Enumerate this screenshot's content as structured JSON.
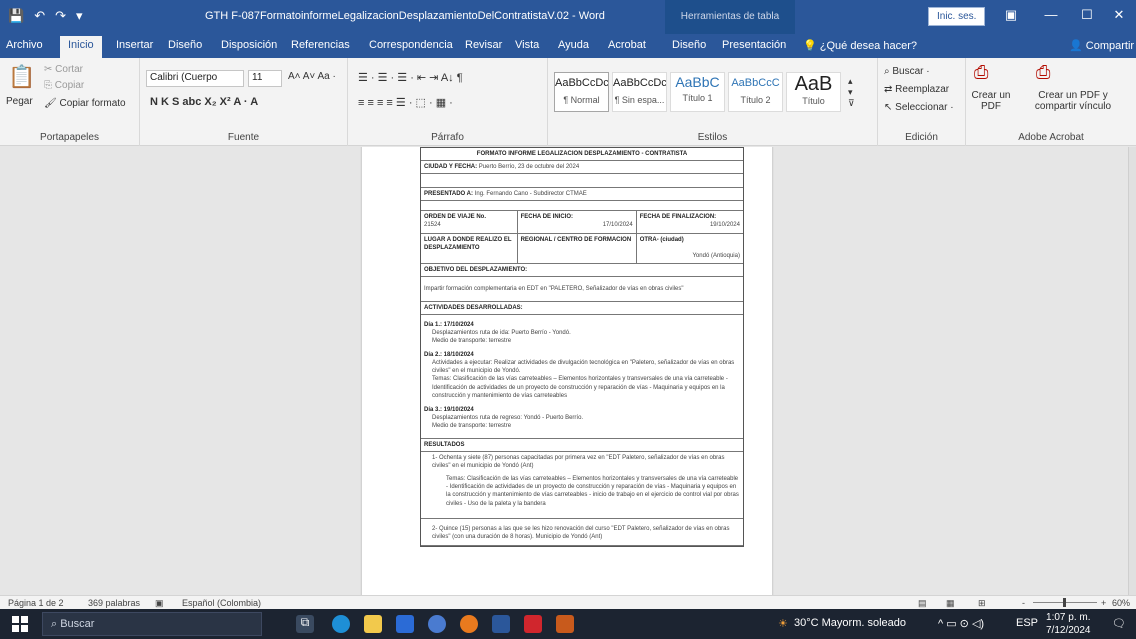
{
  "titlebar": {
    "quick_access": [
      "💾",
      "↶",
      "↷",
      "▾"
    ],
    "doc_title": "GTH F-087FormatoinformeLegalizacionDesplazamientoDelContratistaV.02 - Word",
    "table_tools": "Herramientas de tabla",
    "sign_in": "Inic. ses.",
    "ribbon_display": "▣",
    "minimize": "—",
    "maximize": "☐",
    "close": "✕"
  },
  "tabs": {
    "items": [
      "Archivo",
      "Inicio",
      "Insertar",
      "Diseño",
      "Disposición",
      "Referencias",
      "Correspondencia",
      "Revisar",
      "Vista",
      "Ayuda",
      "Acrobat",
      "Diseño",
      "Presentación"
    ],
    "active_index": 1,
    "tell_me": "¿Qué desea hacer?",
    "share": "Compartir"
  },
  "ribbon": {
    "clipboard": {
      "label": "Portapapeles",
      "paste": "Pegar",
      "cut": "Cortar",
      "copy": "Copiar",
      "format_painter": "Copiar formato"
    },
    "font": {
      "label": "Fuente",
      "name": "Calibri (Cuerpo",
      "size": "11",
      "row2": "N  K  S  abc  X₂  X²   A  ·  A"
    },
    "paragraph": {
      "label": "Párrafo",
      "row1": "☰ · ☰ · ☰ ·   ⇤  ⇥   A↓  ¶",
      "row2": "≡  ≡  ≡  ≡   ☰ ·   ⬚ ·  ▦ ·"
    },
    "styles": {
      "label": "Estilos",
      "items": [
        {
          "preview": "AaBbCcDc",
          "name": "¶ Normal"
        },
        {
          "preview": "AaBbCcDc",
          "name": "¶ Sin espa..."
        },
        {
          "preview": "AaBbC",
          "name": "Título 1"
        },
        {
          "preview": "AaBbCcC",
          "name": "Título 2"
        },
        {
          "preview": "AaB",
          "name": "Título"
        }
      ]
    },
    "editing": {
      "label": "Edición",
      "find": "Buscar",
      "replace": "Reemplazar",
      "select": "Seleccionar"
    },
    "acrobat": {
      "label": "Adobe Acrobat",
      "create_pdf": "Crear un PDF",
      "create_share": "Crear un PDF y compartir vínculo"
    }
  },
  "document": {
    "heading": "FORMATO INFORME LEGALIZACION DESPLAZAMIENTO - CONTRATISTA",
    "city_date_label": "CIUDAD Y FECHA:",
    "city_date_value": "Puerto Berrío, 23 de octubre del 2024",
    "presented_label": "PRESENTADO A:",
    "presented_value": "Ing. Fernando Cano - Subdirector CTMAE",
    "order_label": "ORDEN DE VIAJE No.",
    "order_value": "21524",
    "start_label": "FECHA DE INICIO:",
    "start_value": "17/10/2024",
    "end_label": "FECHA DE FINALIZACION:",
    "end_value": "19/10/2024",
    "place_label": "LUGAR A DONDE REALIZO EL DESPLAZAMIENTO",
    "regional_label": "REGIONAL / CENTRO DE FORMACION",
    "other_label": "OTRA- (ciudad)",
    "other_value": "Yondó (Antioquia)",
    "objective_label": "OBJETIVO DEL DESPLAZAMIENTO:",
    "objective_value": "Impartir formación complementaria en EDT en \"PALETERO, Señalizador de vías en obras civiles\"",
    "activities_label": "ACTIVIDADES DESARROLLADAS:",
    "day1_title": "Día 1.: 17/10/2024",
    "day1_lines": [
      "Desplazamientos ruta de ida: Puerto Berrío - Yondó.",
      "Medio de transporte: terrestre"
    ],
    "day2_title": "Día 2.: 18/10/2024",
    "day2_act": "Actividades a ejecutar: Realizar actividades de divulgación tecnológica en \"Paletero, señalizador de vías en obras civiles\" en el municipio de Yondó.",
    "day2_topics": "Temas: Clasificación de las vías carreteables – Elementos horizontales y transversales de una vía carreteable - Identificación de actividades de un proyecto de construcción y reparación de vías - Maquinaria y equipos en la construcción y mantenimiento de vías carreteables",
    "day3_title": "Día 3.: 19/10/2024",
    "day3_lines": [
      "Desplazamientos ruta de regreso: Yondó - Puerto Berrío.",
      "Medio de transporte: terrestre"
    ],
    "results_label": "RESULTADOS",
    "result1": "1-  Ochenta y siete (87) personas capacitadas por primera vez en \"EDT Paletero, señalizador de vías en obras civiles\" en el municipio de Yondó (Ant)",
    "result1_topics": "Temas: Clasificación de las vías carreteables – Elementos horizontales y transversales de una vía carreteable - Identificación de actividades de un proyecto de construcción y reparación de vías - Maquinaria y equipos en la construcción y mantenimiento de vías carreteables - inicio de trabajo en el ejercicio de control vial por obras civiles - Uso de la paleta y la bandera",
    "result2": "2-  Quince (15) personas a las que se les hizo renovación del curso \"EDT Paletero, señalizador de vías en obras civiles\" (con una duración de 8 horas). Municipio de Yondó (Ant)"
  },
  "statusbar": {
    "page": "Página 1 de 2",
    "words": "369 palabras",
    "language": "Español (Colombia)",
    "zoom_minus": "-",
    "zoom_plus": "+",
    "zoom": "60%"
  },
  "taskbar": {
    "search": "Buscar",
    "weather": "30°C  Mayorm. soleado",
    "tray_icons": "^  ▭  ⊙  ◁)",
    "lang": "ESP",
    "time": "1:07 p. m.",
    "date": "7/12/2024"
  }
}
